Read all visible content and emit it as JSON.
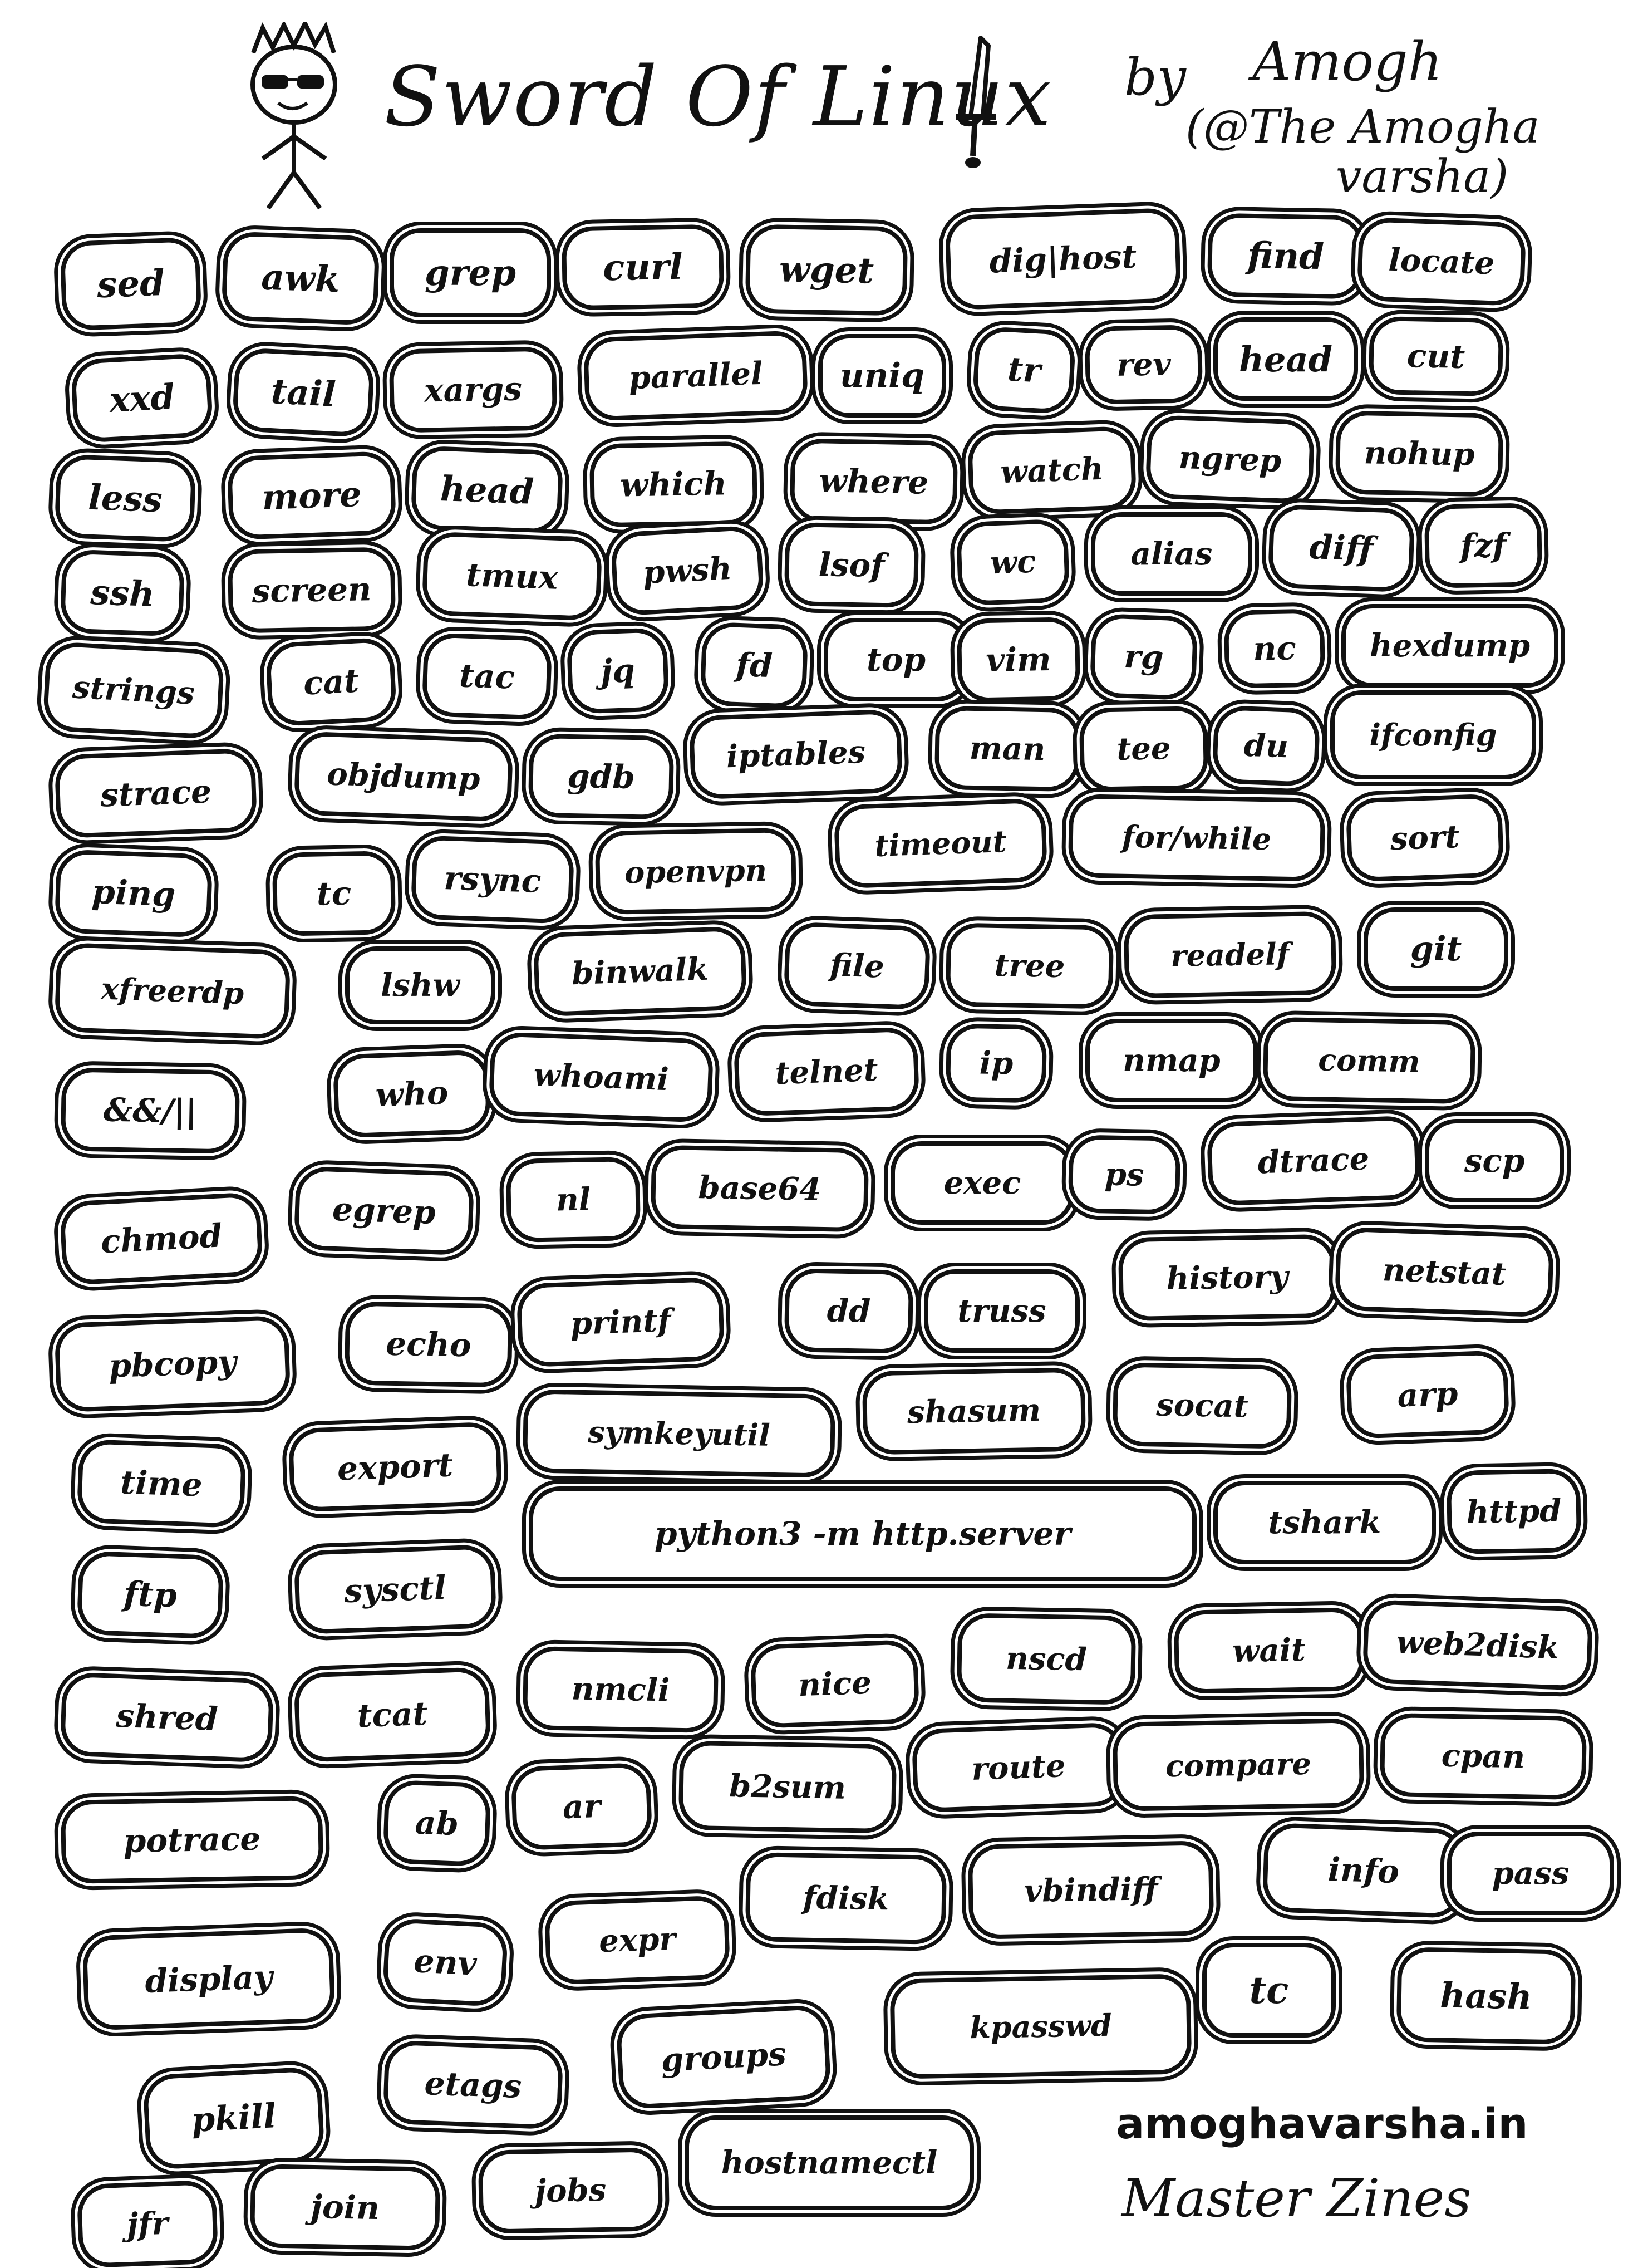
{
  "header": {
    "title": "Sword Of Linux",
    "by": "by",
    "author": "Amogh",
    "handle_line1": "(@The Amogha",
    "handle_line2": "varsha)"
  },
  "footer": {
    "website": "amoghavarsha.in",
    "series": "Master Zines"
  },
  "commands": [
    {
      "label": "sed"
    },
    {
      "label": "awk"
    },
    {
      "label": "grep"
    },
    {
      "label": "curl"
    },
    {
      "label": "wget"
    },
    {
      "label": "dig|host"
    },
    {
      "label": "find"
    },
    {
      "label": "locate"
    },
    {
      "label": "xxd"
    },
    {
      "label": "tail"
    },
    {
      "label": "xargs"
    },
    {
      "label": "parallel"
    },
    {
      "label": "uniq"
    },
    {
      "label": "tr"
    },
    {
      "label": "rev"
    },
    {
      "label": "head"
    },
    {
      "label": "cut"
    },
    {
      "label": "less"
    },
    {
      "label": "more"
    },
    {
      "label": "head"
    },
    {
      "label": "which"
    },
    {
      "label": "where"
    },
    {
      "label": "watch"
    },
    {
      "label": "ngrep"
    },
    {
      "label": "nohup"
    },
    {
      "label": "ssh"
    },
    {
      "label": "screen"
    },
    {
      "label": "tmux"
    },
    {
      "label": "pwsh"
    },
    {
      "label": "lsof"
    },
    {
      "label": "wc"
    },
    {
      "label": "alias"
    },
    {
      "label": "diff"
    },
    {
      "label": "fzf"
    },
    {
      "label": "strings"
    },
    {
      "label": "cat"
    },
    {
      "label": "tac"
    },
    {
      "label": "jq"
    },
    {
      "label": "fd"
    },
    {
      "label": "top"
    },
    {
      "label": "vim"
    },
    {
      "label": "rg"
    },
    {
      "label": "nc"
    },
    {
      "label": "hexdump"
    },
    {
      "label": "strace"
    },
    {
      "label": "objdump"
    },
    {
      "label": "gdb"
    },
    {
      "label": "iptables"
    },
    {
      "label": "man"
    },
    {
      "label": "tee"
    },
    {
      "label": "du"
    },
    {
      "label": "ifconfig"
    },
    {
      "label": "ping"
    },
    {
      "label": "tc"
    },
    {
      "label": "rsync"
    },
    {
      "label": "openvpn"
    },
    {
      "label": "timeout"
    },
    {
      "label": "for/while"
    },
    {
      "label": "sort"
    },
    {
      "label": "xfreerdp"
    },
    {
      "label": "lshw"
    },
    {
      "label": "binwalk"
    },
    {
      "label": "file"
    },
    {
      "label": "tree"
    },
    {
      "label": "readelf"
    },
    {
      "label": "git"
    },
    {
      "label": "&&/||"
    },
    {
      "label": "who"
    },
    {
      "label": "whoami"
    },
    {
      "label": "telnet"
    },
    {
      "label": "ip"
    },
    {
      "label": "nmap"
    },
    {
      "label": "comm"
    },
    {
      "label": "chmod"
    },
    {
      "label": "egrep"
    },
    {
      "label": "nl"
    },
    {
      "label": "base64"
    },
    {
      "label": "exec"
    },
    {
      "label": "ps"
    },
    {
      "label": "dtrace"
    },
    {
      "label": "scp"
    },
    {
      "label": "pbcopy"
    },
    {
      "label": "echo"
    },
    {
      "label": "printf"
    },
    {
      "label": "dd"
    },
    {
      "label": "truss"
    },
    {
      "label": "history"
    },
    {
      "label": "netstat"
    },
    {
      "label": "time"
    },
    {
      "label": "export"
    },
    {
      "label": "symkeyutil"
    },
    {
      "label": "shasum"
    },
    {
      "label": "socat"
    },
    {
      "label": "arp"
    },
    {
      "label": "ftp"
    },
    {
      "label": "sysctl"
    },
    {
      "label": "python3 -m http.server"
    },
    {
      "label": "tshark"
    },
    {
      "label": "httpd"
    },
    {
      "label": "shred"
    },
    {
      "label": "tcat"
    },
    {
      "label": "nmcli"
    },
    {
      "label": "nice"
    },
    {
      "label": "nscd"
    },
    {
      "label": "wait"
    },
    {
      "label": "web2disk"
    },
    {
      "label": "potrace"
    },
    {
      "label": "ab"
    },
    {
      "label": "ar"
    },
    {
      "label": "b2sum"
    },
    {
      "label": "route"
    },
    {
      "label": "compare"
    },
    {
      "label": "cpan"
    },
    {
      "label": "display"
    },
    {
      "label": "env"
    },
    {
      "label": "expr"
    },
    {
      "label": "fdisk"
    },
    {
      "label": "vbindiff"
    },
    {
      "label": "info"
    },
    {
      "label": "pass"
    },
    {
      "label": "pkill"
    },
    {
      "label": "etags"
    },
    {
      "label": "groups"
    },
    {
      "label": "kpasswd"
    },
    {
      "label": "tc"
    },
    {
      "label": "hash"
    },
    {
      "label": "jfr"
    },
    {
      "label": "join"
    },
    {
      "label": "jobs"
    },
    {
      "label": "hostnamectl"
    }
  ]
}
